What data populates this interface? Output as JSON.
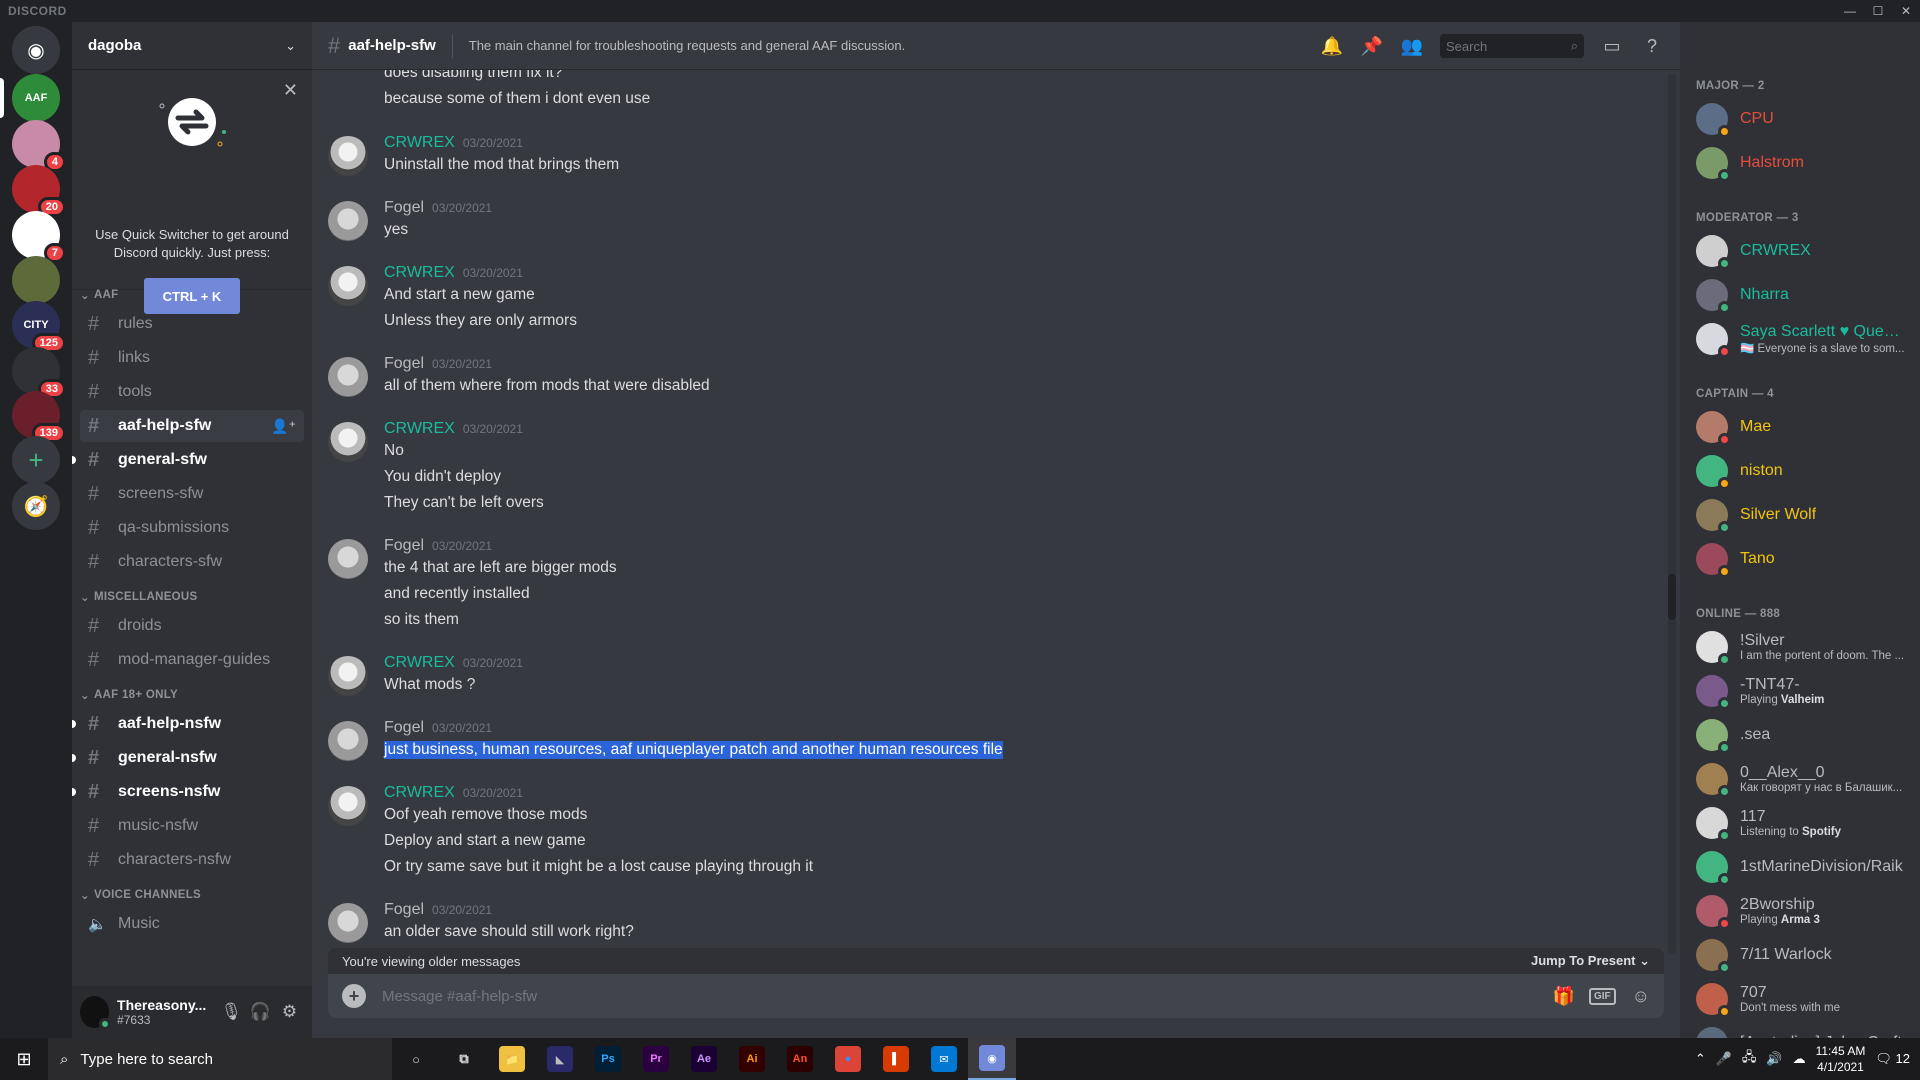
{
  "window": {
    "brand": "DISCORD",
    "controls": [
      "—",
      "☐",
      "✕"
    ]
  },
  "servers": {
    "items": [
      {
        "name": "home",
        "color": "#36393f",
        "glyph": "◉",
        "badge": ""
      },
      {
        "name": "aaf",
        "color": "#2e8b3a",
        "glyph": "AAF",
        "badge": ""
      },
      {
        "name": "anime",
        "color": "#c98aa8",
        "glyph": "",
        "badge": "4"
      },
      {
        "name": "red-lips",
        "color": "#b3262b",
        "glyph": "",
        "badge": "20"
      },
      {
        "name": "among",
        "color": "#ffffff",
        "glyph": "",
        "badge": "7"
      },
      {
        "name": "creature",
        "color": "#5d6b3a",
        "glyph": "",
        "badge": ""
      },
      {
        "name": "city",
        "color": "#2c2f55",
        "glyph": "CITY",
        "badge": "125"
      },
      {
        "name": "leaf",
        "color": "#2f3136",
        "glyph": "",
        "badge": "33"
      },
      {
        "name": "hero",
        "color": "#6a1f2b",
        "glyph": "",
        "badge": "139"
      }
    ],
    "add_label": "+",
    "explore_label": "🧭"
  },
  "sidebar": {
    "guild_name": "dagoba",
    "quick_switcher": {
      "text": "Use Quick Switcher to get around Discord quickly. Just press:",
      "shortcut": "CTRL + K"
    },
    "categories": [
      {
        "label": "AAF",
        "channels": [
          {
            "label": "rules",
            "state": ""
          },
          {
            "label": "links",
            "state": ""
          },
          {
            "label": "tools",
            "state": ""
          },
          {
            "label": "aaf-help-sfw",
            "state": "active"
          },
          {
            "label": "general-sfw",
            "state": "unread"
          },
          {
            "label": "screens-sfw",
            "state": ""
          },
          {
            "label": "qa-submissions",
            "state": ""
          },
          {
            "label": "characters-sfw",
            "state": ""
          }
        ]
      },
      {
        "label": "MISCELLANEOUS",
        "channels": [
          {
            "label": "droids",
            "state": ""
          },
          {
            "label": "mod-manager-guides",
            "state": ""
          }
        ]
      },
      {
        "label": "AAF 18+ ONLY",
        "channels": [
          {
            "label": "aaf-help-nsfw",
            "state": "unread"
          },
          {
            "label": "general-nsfw",
            "state": "unread"
          },
          {
            "label": "screens-nsfw",
            "state": "unread"
          },
          {
            "label": "music-nsfw",
            "state": ""
          },
          {
            "label": "characters-nsfw",
            "state": ""
          }
        ]
      },
      {
        "label": "VOICE CHANNELS",
        "channels": [
          {
            "label": "Music",
            "state": "voice"
          }
        ]
      }
    ],
    "user": {
      "name": "Thereasony...",
      "tag": "#7633"
    }
  },
  "chat": {
    "channel": "aaf-help-sfw",
    "topic": "The main channel for troubleshooting requests and general AAF discussion.",
    "search_placeholder": "Search",
    "partial_top": "does disabling them fix it?",
    "messages": [
      {
        "author": "",
        "kind": "cont",
        "lines": [
          "because some of them i dont even use"
        ]
      },
      {
        "author": "CRWREX",
        "kind": "crw",
        "ts": "03/20/2021",
        "lines": [
          "Uninstall the mod that brings them"
        ]
      },
      {
        "author": "Fogel",
        "kind": "fog",
        "ts": "03/20/2021",
        "lines": [
          "yes"
        ]
      },
      {
        "author": "CRWREX",
        "kind": "crw",
        "ts": "03/20/2021",
        "lines": [
          "And start a new game",
          "Unless they are only armors"
        ]
      },
      {
        "author": "Fogel",
        "kind": "fog",
        "ts": "03/20/2021",
        "lines": [
          "all of them where from mods that were disabled"
        ]
      },
      {
        "author": "CRWREX",
        "kind": "crw",
        "ts": "03/20/2021",
        "lines": [
          "No",
          "You didn't deploy",
          "They can't be left overs"
        ]
      },
      {
        "author": "Fogel",
        "kind": "fog",
        "ts": "03/20/2021",
        "lines": [
          "the 4 that are left are bigger mods",
          "and recently installed",
          "so its them"
        ]
      },
      {
        "author": "CRWREX",
        "kind": "crw",
        "ts": "03/20/2021",
        "lines": [
          "What mods ?"
        ]
      },
      {
        "author": "Fogel",
        "kind": "fog",
        "ts": "03/20/2021",
        "selected": true,
        "lines": [
          "just business, human resources, aaf uniqueplayer patch and another human resources file"
        ]
      },
      {
        "author": "CRWREX",
        "kind": "crw",
        "ts": "03/20/2021",
        "lines": [
          "Oof yeah remove those mods",
          "Deploy and start a new game",
          "Or try same save but it might be a lost cause playing through it"
        ]
      },
      {
        "author": "Fogel",
        "kind": "fog",
        "ts": "03/20/2021",
        "lines": [
          "an older save should still work right?"
        ]
      }
    ],
    "older_notice": "You're viewing older messages",
    "jump_label": "Jump To Present",
    "composer_placeholder": "Message #aaf-help-sfw",
    "gif_label": "GIF"
  },
  "members": {
    "groups": [
      {
        "label": "MAJOR — 2",
        "members": [
          {
            "name": "CPU",
            "color": "#e74c3c",
            "status_dot": "#faa61a",
            "activity": "",
            "activity_bold": "",
            "av": "#5b6d87"
          },
          {
            "name": "Halstrom",
            "color": "#e74c3c",
            "status_dot": "#43b581",
            "activity": "",
            "activity_bold": "",
            "av": "#7a9a6a"
          }
        ]
      },
      {
        "label": "MODERATOR — 3",
        "members": [
          {
            "name": "CRWREX",
            "color": "#1abc9c",
            "status_dot": "#43b581",
            "activity": "",
            "activity_bold": "",
            "av": "#cfcfcf"
          },
          {
            "name": "Nharra",
            "color": "#1abc9c",
            "status_dot": "#43b581",
            "activity": "",
            "activity_bold": "",
            "av": "#6b6b7b"
          },
          {
            "name": "Saya Scarlett ♥ Queen ...",
            "color": "#1abc9c",
            "status_dot": "#f04747",
            "activity": "🏳️‍⚧️ Everyone is a slave to som...",
            "activity_bold": "",
            "av": "#d8d8e0"
          }
        ]
      },
      {
        "label": "CAPTAIN — 4",
        "members": [
          {
            "name": "Mae",
            "color": "#f1c40f",
            "status_dot": "#f04747",
            "activity": "",
            "activity_bold": "",
            "av": "#b47a6a"
          },
          {
            "name": "niston",
            "color": "#f1c40f",
            "status_dot": "#faa61a",
            "activity": "",
            "activity_bold": "",
            "av": "#43b581"
          },
          {
            "name": "Silver Wolf",
            "color": "#f1c40f",
            "status_dot": "#43b581",
            "activity": "",
            "activity_bold": "",
            "av": "#8a7a5a"
          },
          {
            "name": "Tano",
            "color": "#f1c40f",
            "status_dot": "#faa61a",
            "activity": "",
            "activity_bold": "",
            "av": "#9a4a5a"
          }
        ]
      },
      {
        "label": "ONLINE — 888",
        "members": [
          {
            "name": "!Silver",
            "color": "#b9bbbe",
            "status_dot": "#43b581",
            "activity": "I am the portent of doom. The ...",
            "activity_bold": "",
            "av": "#e0e0e0"
          },
          {
            "name": "-TNT47-",
            "color": "#b9bbbe",
            "status_dot": "#43b581",
            "activity": "Playing ",
            "activity_bold": "Valheim",
            "av": "#7a5a8a"
          },
          {
            "name": ".sea",
            "color": "#b9bbbe",
            "status_dot": "#43b581",
            "activity": "",
            "activity_bold": "",
            "av": "#8ab07a"
          },
          {
            "name": "0__Alex__0",
            "color": "#b9bbbe",
            "status_dot": "#43b581",
            "activity": "Как говорят у нас в Балашик...",
            "activity_bold": "",
            "av": "#a08050"
          },
          {
            "name": "117",
            "color": "#b9bbbe",
            "status_dot": "#43b581",
            "activity": "Listening to ",
            "activity_bold": "Spotify",
            "av": "#d8d8d8"
          },
          {
            "name": "1stMarineDivision/Raik",
            "color": "#b9bbbe",
            "status_dot": "#43b581",
            "activity": "",
            "activity_bold": "",
            "av": "#43b581"
          },
          {
            "name": "2Bworship",
            "color": "#b9bbbe",
            "status_dot": "#f04747",
            "activity": "Playing ",
            "activity_bold": "Arma 3",
            "av": "#b05a6a"
          },
          {
            "name": "7/11 Warlock",
            "color": "#b9bbbe",
            "status_dot": "#43b581",
            "activity": "",
            "activity_bold": "",
            "av": "#8a7050"
          },
          {
            "name": "707",
            "color": "#b9bbbe",
            "status_dot": "#faa61a",
            "activity": "Don't mess with me",
            "activity_bold": "",
            "av": "#c0604a"
          },
          {
            "name": "[Australian] JohnyCraft",
            "color": "#b9bbbe",
            "status_dot": "#43b581",
            "activity": "",
            "activity_bold": "",
            "av": "#5a6a7a"
          }
        ]
      }
    ]
  },
  "taskbar": {
    "search_placeholder": "Type here to search",
    "apps": [
      {
        "name": "explorer",
        "label": "📁",
        "bg": "#f0c040",
        "fg": "#222"
      },
      {
        "name": "vs",
        "label": "◣",
        "bg": "#2a2a6a",
        "fg": "#bbb"
      },
      {
        "name": "photoshop",
        "label": "Ps",
        "bg": "#001e36",
        "fg": "#31a8ff"
      },
      {
        "name": "premiere",
        "label": "Pr",
        "bg": "#2a003f",
        "fg": "#ea77ff"
      },
      {
        "name": "after-effects",
        "label": "Ae",
        "bg": "#1a0033",
        "fg": "#cf96fd"
      },
      {
        "name": "illustrator",
        "label": "Ai",
        "bg": "#330000",
        "fg": "#ff9a00"
      },
      {
        "name": "animate",
        "label": "An",
        "bg": "#2a0000",
        "fg": "#ff4f1f"
      },
      {
        "name": "chrome",
        "label": "●",
        "bg": "#db4437",
        "fg": "#4285f4"
      },
      {
        "name": "office",
        "label": "▌",
        "bg": "#d83b01",
        "fg": "#fff"
      },
      {
        "name": "mail",
        "label": "✉",
        "bg": "#0078d4",
        "fg": "#fff"
      },
      {
        "name": "discord",
        "label": "◉",
        "bg": "#7289da",
        "fg": "#fff"
      }
    ],
    "time": "11:45 AM",
    "date": "4/1/2021",
    "notif_count": "12"
  }
}
